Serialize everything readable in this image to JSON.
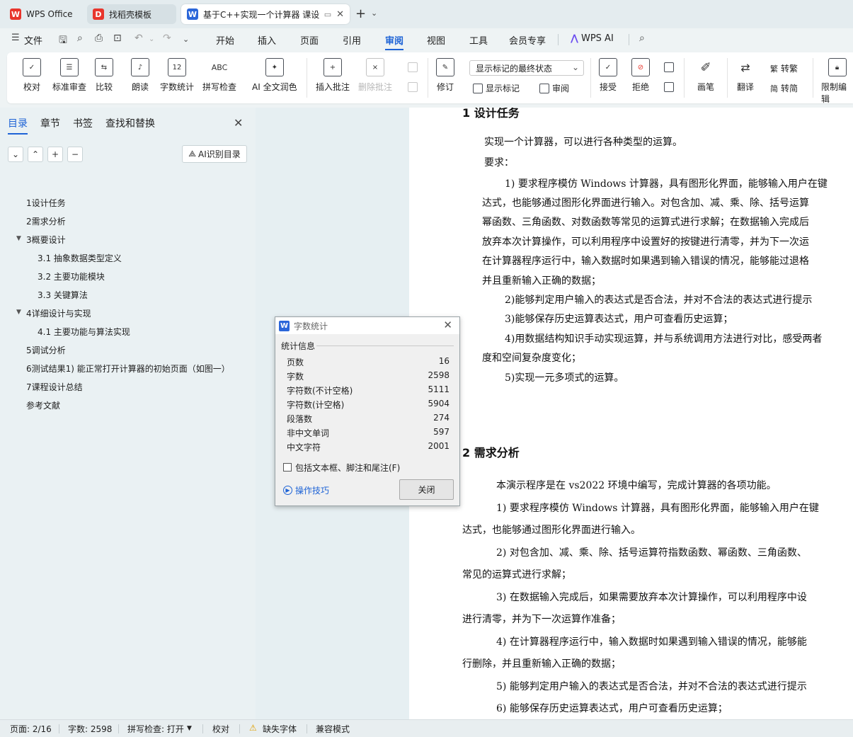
{
  "tabs": [
    {
      "label": "WPS Office",
      "icon": "wps-logo-icon"
    },
    {
      "label": "找稻壳模板",
      "icon": "docer-icon"
    },
    {
      "label": "基于C++实现一个计算器 课设",
      "icon": "word-doc-icon"
    }
  ],
  "menu": {
    "file_label": "文件",
    "items": [
      "开始",
      "插入",
      "页面",
      "引用",
      "审阅",
      "视图",
      "工具",
      "会员专享",
      "WPS AI"
    ],
    "active": "审阅"
  },
  "ribbon": {
    "proofread": "校对",
    "standard_review": "标准审查",
    "compare": "比较",
    "read_aloud": "朗读",
    "word_count": "字数统计",
    "spell_check": "拼写检查",
    "ai_polish": "AI 全文润色",
    "insert_comment": "插入批注",
    "delete_comment": "删除批注",
    "track_changes": "修订",
    "markup_select": "显示标记的最终状态",
    "show_markup": "显示标记",
    "review_pane": "审阅",
    "accept": "接受",
    "reject": "拒绝",
    "pen": "画笔",
    "translate": "翻译",
    "to_traditional": "转繁",
    "to_simplified": "转简",
    "restrict_edit": "限制编辑"
  },
  "nav": {
    "tabs": [
      "目录",
      "章节",
      "书签",
      "查找和替换"
    ],
    "ai_toc_label": "AI识别目录",
    "toc": [
      {
        "text": "1设计任务",
        "level": 1
      },
      {
        "text": "2需求分析",
        "level": 1
      },
      {
        "text": "3概要设计",
        "level": 1,
        "expanded": true
      },
      {
        "text": "3.1 抽象数据类型定义",
        "level": 2
      },
      {
        "text": "3.2  主要功能模块",
        "level": 2
      },
      {
        "text": "3.3  关键算法",
        "level": 2
      },
      {
        "text": "4详细设计与实现",
        "level": 1,
        "expanded": true
      },
      {
        "text": "4.1  主要功能与算法实现",
        "level": 2
      },
      {
        "text": "5调试分析",
        "level": 1
      },
      {
        "text": "6测试结果1)   能正常打开计算器的初始页面（如图一）",
        "level": 1
      },
      {
        "text": "7课程设计总结",
        "level": 1
      },
      {
        "text": "参考文献",
        "level": 1
      }
    ]
  },
  "document": {
    "heading1": "1  设计任务",
    "p1": "实现一个计算器，可以进行各种类型的运算。",
    "p2": "要求：",
    "p3": "1)  要求程序模仿 Windows 计算器，具有图形化界面，能够输入用户在键",
    "p4": "达式，也能够通过图形化界面进行输入。对包含加、减、乘、除、括号运算",
    "p5": "幂函数、三角函数、对数函数等常见的运算式进行求解；在数据输入完成后",
    "p6": "放弃本次计算操作，可以利用程序中设置好的按键进行清零，并为下一次运",
    "p7": "在计算器程序运行中，输入数据时如果遇到输入错误的情况，能够能过退格",
    "p8": "并且重新输入正确的数据；",
    "p9": "2)能够判定用户输入的表达式是否合法，并对不合法的表达式进行提示",
    "p10": "3)能够保存历史运算表达式，用户可查看历史运算；",
    "p11": "4)用数据结构知识手动实现运算，并与系统调用方法进行对比，感受两者",
    "p12": "度和空间复杂度变化；",
    "p13": "5)实现一元多项式的运算。",
    "heading2": "2  需求分析",
    "q1": "本演示程序是在 vs2022 环境中编写，完成计算器的各项功能。",
    "q2": "1)     要求程序模仿 Windows 计算器，具有图形化界面，能够输入用户在键",
    "q3": "达式，也能够通过图形化界面进行输入。",
    "q4": "2)     对包含加、减、乘、除、括号运算符指数函数、幂函数、三角函数、",
    "q5": "常见的运算式进行求解；",
    "q6": "3)     在数据输入完成后，如果需要放弃本次计算操作，可以利用程序中设",
    "q7": "进行清零，并为下一次运算作准备；",
    "q8": "4)     在计算器程序运行中，输入数据时如果遇到输入错误的情况，能够能",
    "q9": "行删除，并且重新输入正确的数据；",
    "q10": "5)     能够判定用户输入的表达式是否合法，并对不合法的表达式进行提示",
    "q11": "6)     能够保存历史运算表达式，用户可查看历史运算；"
  },
  "dialog": {
    "title": "字数统计",
    "group": "统计信息",
    "stats": [
      {
        "label": "页数",
        "value": "16"
      },
      {
        "label": "字数",
        "value": "2598"
      },
      {
        "label": "字符数(不计空格)",
        "value": "5111"
      },
      {
        "label": "字符数(计空格)",
        "value": "5904"
      },
      {
        "label": "段落数",
        "value": "274"
      },
      {
        "label": "非中文单词",
        "value": "597"
      },
      {
        "label": "中文字符",
        "value": "2001"
      }
    ],
    "checkbox_label": "包括文本框、脚注和尾注(F)",
    "checkbox_checked": false,
    "tips": "操作技巧",
    "close": "关闭"
  },
  "status": {
    "page": "页面: 2/16",
    "words": "字数: 2598",
    "spell": "拼写检查: 打开",
    "proof": "校对",
    "missing_font": "缺失字体",
    "compat": "兼容模式"
  },
  "colors": {
    "accent": "#1e63d6",
    "wps_red": "#e8352c",
    "word_blue": "#2b66d9"
  }
}
